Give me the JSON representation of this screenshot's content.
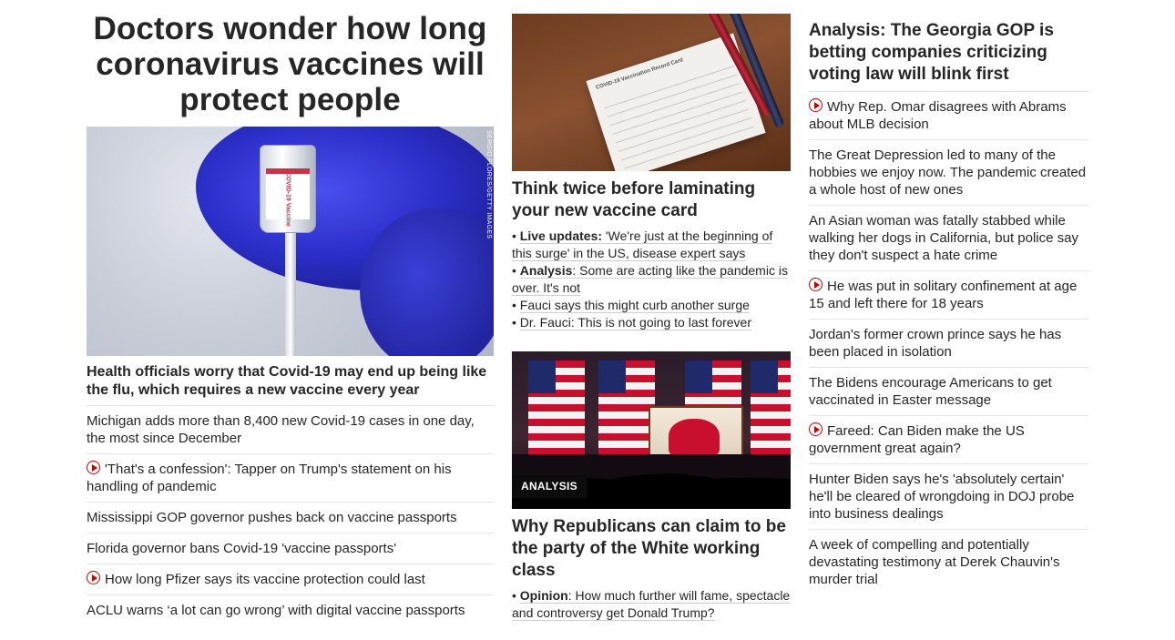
{
  "col1": {
    "headline": "Doctors wonder how long coronavirus vaccines will protect people",
    "photo_credit": "SERGIO FLORES/GETTY IMAGES",
    "vial_text": "COVID-19 Vaccine",
    "lead": "Health officials worry that Covid-19 may end up being like the flu, which requires a new vaccine every year",
    "items": [
      {
        "text": "Michigan adds more than 8,400 new Covid-19 cases in one day, the most since December",
        "video": false
      },
      {
        "text": "'That's a confession': Tapper on Trump's statement on his handling of pandemic",
        "video": true
      },
      {
        "text": "Mississippi GOP governor pushes back on vaccine passports",
        "video": false
      },
      {
        "text": "Florida governor bans Covid-19 'vaccine passports'",
        "video": false
      },
      {
        "text": "How long Pfizer says its vaccine protection could last",
        "video": true
      },
      {
        "text": "ACLU warns ‘a lot can go wrong’ with digital vaccine passports",
        "video": false
      }
    ]
  },
  "col2": {
    "story1": {
      "card_text": "COVID-19 Vaccination Record Card",
      "title": "Think twice before laminating your new vaccine card",
      "bullets": [
        {
          "bold": "Live updates:",
          "text": " 'We're just at the beginning of this surge' in the US, disease expert says"
        },
        {
          "bold": "Analysis",
          "text": ": Some are acting like the pandemic is over. It's not"
        },
        {
          "bold": "",
          "text": "Fauci says this might curb another surge"
        },
        {
          "bold": "",
          "text": "Dr. Fauci: This is not going to last forever"
        }
      ]
    },
    "story2": {
      "tag": "ANALYSIS",
      "title": "Why Republicans can claim to be the party of the White working class",
      "bullets": [
        {
          "bold": "Opinion",
          "text": ": How much further will fame, spectacle and controversy get Donald Trump?"
        }
      ]
    }
  },
  "col3": {
    "headline": "Analysis: The Georgia GOP is betting companies criticizing voting law will blink first",
    "items": [
      {
        "text": "Why Rep. Omar disagrees with Abrams about MLB decision",
        "video": true
      },
      {
        "text": "The Great Depression led to many of the hobbies we enjoy now. The pandemic created a whole host of new ones",
        "video": false
      },
      {
        "text": "An Asian woman was fatally stabbed while walking her dogs in California, but police say they don't suspect a hate crime",
        "video": false
      },
      {
        "text": "He was put in solitary confinement at age 15 and left there for 18 years",
        "video": true
      },
      {
        "text": "Jordan's former crown prince says he has been placed in isolation",
        "video": false
      },
      {
        "text": "The Bidens encourage Americans to get vaccinated in Easter message",
        "video": false
      },
      {
        "text": "Fareed: Can Biden make the US government great again?",
        "video": true
      },
      {
        "text": "Hunter Biden says he's 'absolutely certain' he'll be cleared of wrongdoing in DOJ probe into business dealings",
        "video": false
      },
      {
        "text": "A week of compelling and potentially devastating testimony at Derek Chauvin's murder trial",
        "video": false
      }
    ]
  },
  "colors": {
    "text": "#262626",
    "video_icon": "#cc0000",
    "divider": "#e6e6e6",
    "tag_bg": "#0c0c0c"
  }
}
